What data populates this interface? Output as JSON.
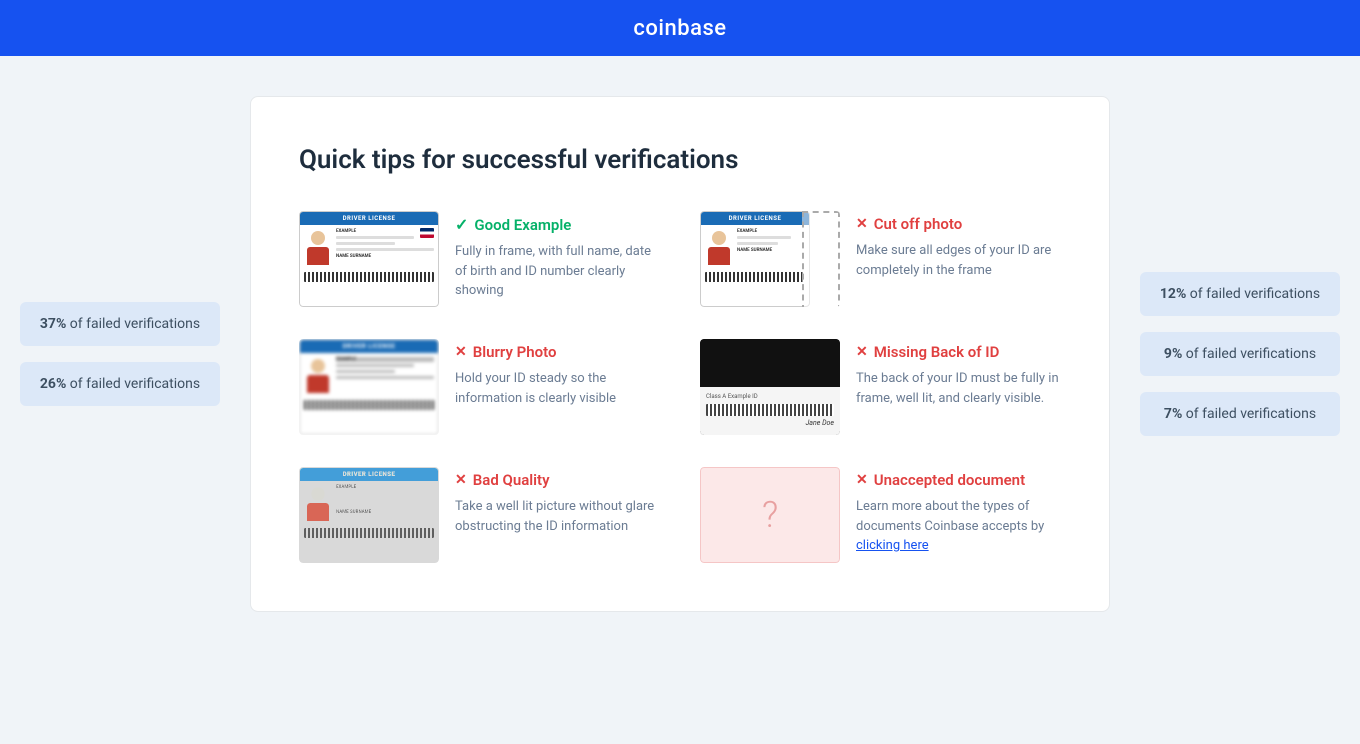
{
  "header": {
    "logo": "coinbase"
  },
  "page": {
    "title": "Quick tips for successful verifications"
  },
  "left_badges": [
    {
      "percent": "37%",
      "label": "of failed verifications"
    },
    {
      "percent": "26%",
      "label": "of failed verifications"
    }
  ],
  "right_badges": [
    {
      "percent": "12%",
      "label": "of failed verifications"
    },
    {
      "percent": "9%",
      "label": "of failed verifications"
    },
    {
      "percent": "7%",
      "label": "of failed verifications"
    }
  ],
  "tips": [
    {
      "id": "good-example",
      "type": "good",
      "icon": "✓",
      "title": "Good Example",
      "description": "Fully in frame, with full name, date of birth and ID number clearly showing",
      "image_type": "dl-normal"
    },
    {
      "id": "cut-off-photo",
      "type": "bad",
      "icon": "✕",
      "title": "Cut off photo",
      "description": "Make sure all edges of your ID are completely in the frame",
      "image_type": "dl-cutoff"
    },
    {
      "id": "blurry-photo",
      "type": "bad",
      "icon": "✕",
      "title": "Blurry Photo",
      "description": "Hold your ID steady so the information is clearly visible",
      "image_type": "dl-blurry"
    },
    {
      "id": "missing-back",
      "type": "bad",
      "icon": "✕",
      "title": "Missing Back of ID",
      "description": "The back of your ID must be fully in frame, well lit, and clearly visible.",
      "image_type": "dl-back"
    },
    {
      "id": "bad-quality",
      "type": "bad",
      "icon": "✕",
      "title": "Bad Quality",
      "description": "Take a well lit picture without glare obstructing the ID information",
      "image_type": "dl-bad"
    },
    {
      "id": "unaccepted-doc",
      "type": "bad",
      "icon": "✕",
      "title": "Unaccepted document",
      "description": "Learn more about the types of documents Coinbase accepts by",
      "link_text": "clicking here",
      "image_type": "unaccepted"
    }
  ]
}
